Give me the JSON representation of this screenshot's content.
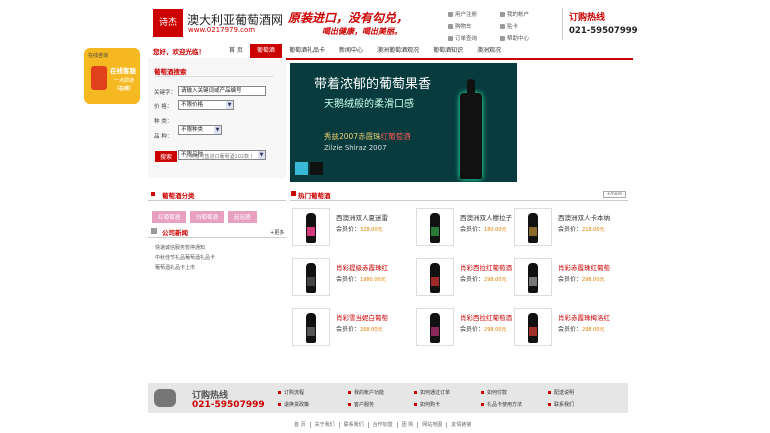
{
  "header": {
    "logo": "诗杰",
    "brand": "澳大利亚葡萄酒网",
    "url": "www.0217979.com",
    "slogan1": "原装进口，没有勾兑，",
    "slogan2": "喝出健康，喝出美丽。",
    "top_links": [
      "用户注册",
      "我的帐户",
      "购物车",
      "贴卡",
      "订单查询",
      "帮助中心"
    ],
    "hotline_title": "订购热线",
    "hotline_number": "021-59507999"
  },
  "welcome": "您好，欢迎光临！",
  "nav": [
    "首 页",
    "葡萄酒",
    "葡萄酒礼品卡",
    "新闻中心",
    "澳洲葡萄酒观况",
    "葡萄酒知识",
    "澳洲观况"
  ],
  "float_widget": {
    "caption": "在线咨询",
    "line1": "在线客服",
    "line2": "一点即通",
    "line3": "（在线）"
  },
  "search": {
    "title": "葡萄酒搜索",
    "keyword_label": "关键字：",
    "keyword_value": "请输入关键词或产品编号",
    "price_label": "价  格：",
    "price_value": "不限价格",
    "type_label": "种  类：",
    "type_value": "不限种类",
    "variety_label": "品  种：",
    "variety_value": "不限品种",
    "button": "搜索",
    "note": "( 共有可售进口葡萄酒102款 )"
  },
  "banner": {
    "headline1": "带着浓郁的葡萄果香",
    "headline2": "天鹅绒般的柔滑口感",
    "line3_prefix": "秀兹2007赤霞珠",
    "line3_highlight": "红葡萄酒",
    "line4": "Zilzie Shiraz 2007"
  },
  "category": {
    "title": "葡萄酒分类",
    "buttons": [
      "红葡萄酒",
      "白葡萄酒",
      "起泡酒"
    ]
  },
  "news": {
    "title": "公司新闻",
    "more": "+更多",
    "items": [
      "快速诚信服务暂停通知",
      "中秋佳节礼品葡萄酒礼品卡",
      "葡萄酒礼品卡上市"
    ]
  },
  "hot": {
    "title": "热门葡萄酒",
    "more": "+more",
    "price_label": "会员价：",
    "products": [
      {
        "name": "西澳洲双人夏迷雷",
        "price": "328.00元",
        "red": false,
        "color": "#d43a7a"
      },
      {
        "name": "西澳洲双人穆拉子",
        "price": "180.00元",
        "red": false,
        "color": "#2a7a3a"
      },
      {
        "name": "西澳洲双人卡本纳",
        "price": "218.00元",
        "red": false,
        "color": "#8a6a2a"
      },
      {
        "name": "肖彩提级赤霞珠红",
        "price": "1980.00元",
        "red": true,
        "color": "#444"
      },
      {
        "name": "肖彩西拉红葡萄酒",
        "price": "298.00元",
        "red": true,
        "color": "#a02a2a"
      },
      {
        "name": "肖彩赤霞珠红葡萄",
        "price": "298.00元",
        "red": true,
        "color": "#777"
      },
      {
        "name": "肖彩雪当妮白葡萄",
        "price": "268.00元",
        "red": true,
        "color": "#555"
      },
      {
        "name": "肖彩西拉红葡萄酒",
        "price": "298.00元",
        "red": true,
        "color": "#8a2a5a"
      },
      {
        "name": "肖彩赤霞珠梅洛红",
        "price": "298.00元",
        "red": true,
        "color": "#a0302a"
      }
    ]
  },
  "footer": {
    "title": "订购热线",
    "number": "021-59507999",
    "links": [
      "订购流程",
      "我的帐户功能",
      "如何通过订单",
      "如何付款",
      "配送说明",
      "退换货政策",
      "客户服务",
      "如何购卡",
      "礼品卡使用方法",
      "联系我们"
    ]
  },
  "bottom_links": [
    "首 页",
    "关于我们",
    "联系我们",
    "合作加盟",
    "团 购",
    "网站地图",
    "友情链接"
  ]
}
